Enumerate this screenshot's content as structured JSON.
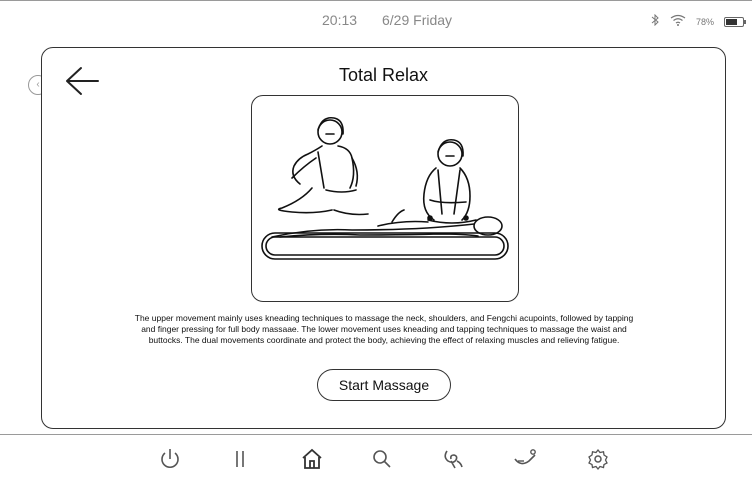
{
  "status_bar": {
    "time": "20:13",
    "date": "6/29 Friday",
    "battery_text": "78%",
    "icons": [
      "bluetooth-icon",
      "wifi-icon",
      "battery-icon"
    ]
  },
  "card": {
    "title": "Total Relax",
    "description": "The upper movement mainly uses kneading techniques to massage the neck, shoulders, and Fengchi acupoints, followed by tapping and finger pressing for full body massaae. The lower movement uses kneading and tapping techniques to massage the waist and buttocks. The dual movements coordinate and protect the body, achieving the effect of relaxing muscles and relieving fatigue.",
    "start_label": "Start Massage",
    "back_icon": "arrow-left-icon",
    "illustration": "massage-illustration"
  },
  "bottom_nav": {
    "items": [
      "power-icon",
      "pause-icon",
      "home-icon",
      "search-icon",
      "swirl-icon",
      "recline-icon",
      "settings-icon"
    ]
  },
  "colors": {
    "stroke": "#333333",
    "muted_text": "#888888",
    "background": "#ffffff"
  }
}
